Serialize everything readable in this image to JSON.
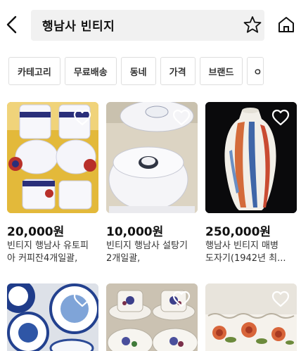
{
  "search": {
    "query": "행남사 빈티지"
  },
  "icons": {
    "back": "chevron-left-icon",
    "favorite": "star-outline-icon",
    "home": "home-icon",
    "like": "heart-outline-icon"
  },
  "filters": [
    {
      "label": "카테고리"
    },
    {
      "label": "무료배송"
    },
    {
      "label": "동네"
    },
    {
      "label": "가격"
    },
    {
      "label": "브랜드"
    },
    {
      "label": "ㅇ"
    }
  ],
  "products": [
    {
      "price": "20,000원",
      "title_line1": "빈티지 행남사 유토피",
      "title_line2": "아 커피잔4개일괄,"
    },
    {
      "price": "10,000원",
      "title_line1": "빈티지 행남사 설탕기",
      "title_line2": "2개일괄,"
    },
    {
      "price": "250,000원",
      "title_line1": "행남사 빈티지 매병",
      "title_line2": "도자기(1942년 최..."
    },
    {
      "price": "",
      "title_line1": "",
      "title_line2": ""
    },
    {
      "price": "",
      "title_line1": "",
      "title_line2": ""
    },
    {
      "price": "",
      "title_line1": "",
      "title_line2": ""
    }
  ],
  "colors": {
    "chip_border": "#dedede",
    "search_bg": "#f1f1f1",
    "text_primary": "#111111",
    "text_secondary": "#333333"
  }
}
